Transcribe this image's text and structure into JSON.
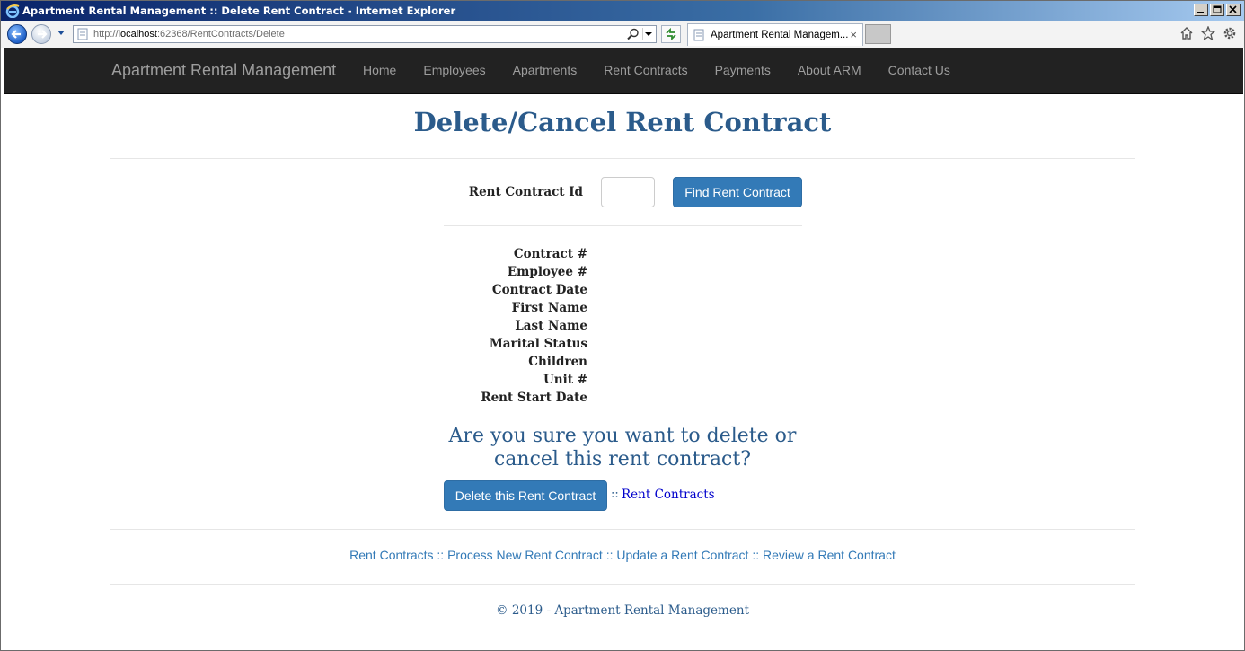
{
  "window": {
    "title": "Apartment Rental Management :: Delete Rent Contract - Internet Explorer"
  },
  "browser": {
    "url_prefix": "http://",
    "url_host": "localhost",
    "url_rest": ":62368/RentContracts/Delete",
    "tab_label": "Apartment Rental Managem...",
    "tab_close": "×",
    "icons": [
      "ie-logo-icon",
      "back-arrow-icon",
      "forward-arrow-icon",
      "search-icon",
      "refresh-icon",
      "home-icon",
      "star-icon",
      "gear-icon"
    ]
  },
  "navbar": {
    "brand": "Apartment Rental Management",
    "links": [
      "Home",
      "Employees",
      "Apartments",
      "Rent Contracts",
      "Payments",
      "About ARM",
      "Contact Us"
    ]
  },
  "main": {
    "title": "Delete/Cancel Rent Contract",
    "search": {
      "label": "Rent Contract Id",
      "value": "",
      "button": "Find Rent Contract"
    },
    "details": [
      "Contract #",
      "Employee #",
      "Contract Date",
      "First Name",
      "Last Name",
      "Marital Status",
      "Children",
      "Unit #",
      "Rent Start Date"
    ],
    "confirm_line1": "Are you sure you want to delete or",
    "confirm_line2": "cancel this rent contract?",
    "delete_button": "Delete this Rent Contract",
    "separator": "::",
    "back_link": "Rent Contracts"
  },
  "bottom_links": {
    "items": [
      "Rent Contracts",
      "Process New Rent Contract",
      "Update a Rent Contract",
      "Review a Rent Contract"
    ],
    "separator": "::"
  },
  "footer": {
    "text": "© 2019 - Apartment Rental Management"
  },
  "colors": {
    "navbar_bg": "#222222",
    "title": "#2b5b8b",
    "button": "#337ab7",
    "link": "#337ab7"
  }
}
